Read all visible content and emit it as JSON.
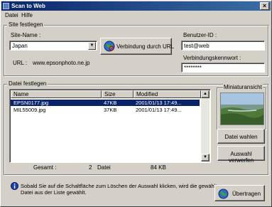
{
  "window": {
    "title": "Scan to Web",
    "close_glyph": "×"
  },
  "menu": {
    "items": [
      "Datei",
      "Hilfe"
    ]
  },
  "site_group": {
    "label": "Site festlegen",
    "site_name_label": "Site-Name :",
    "site_name_value": "Japan",
    "connect_button": "Verbindung durch URL",
    "url_label": "URL :",
    "url_value": "www.epsonphoto.ne.jp",
    "user_id_label": "Benutzer-ID :",
    "user_id_value": "test@web",
    "password_label": "Verbindungskennwort :",
    "password_value": "********"
  },
  "file_group": {
    "label": "Datei festlegen",
    "columns": [
      "Name",
      "Size",
      "Modified"
    ],
    "rows": [
      {
        "name": "EPSN0177.jpg",
        "size": "47KB",
        "modified": "2001/01/13 17:49...",
        "selected": true
      },
      {
        "name": "MIL55009.jpg",
        "size": "37KB",
        "modified": "2001/01/13 17:49...",
        "selected": false
      }
    ],
    "total_label": "Gesamt :",
    "total_count": "2",
    "total_unit": "Datei",
    "total_size": "84 KB",
    "preview_label": "Miniaturansicht",
    "select_button": "Datei wahlen",
    "discard_button": "Auswahl verwerfen"
  },
  "footer": {
    "info_text_line1": "Sobald Sie auf die Schaltfläche zum Löschen der Auswahl klicken, wird die gewählte",
    "info_text_line2": "Datei aus der Liste gewählt.",
    "transfer_button": "Übertragen"
  },
  "colors": {
    "titlebar": "#0a246a",
    "selection": "#0a246a",
    "face": "#d4d0c8"
  }
}
